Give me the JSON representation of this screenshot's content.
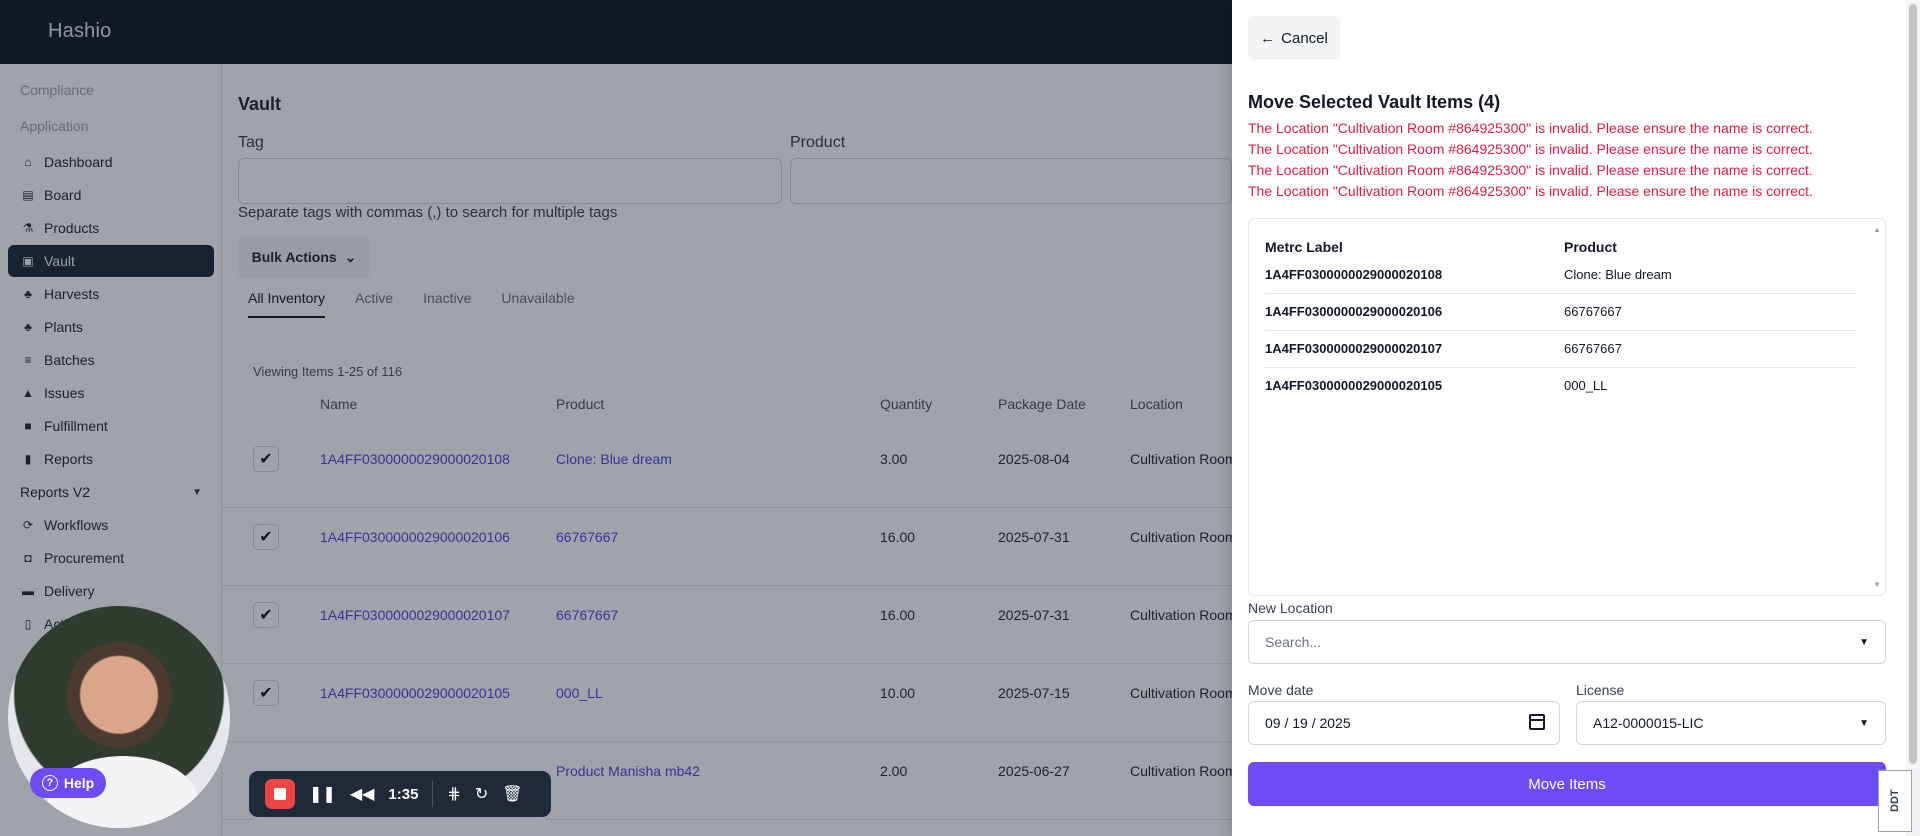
{
  "app": {
    "brand": "Hashio"
  },
  "sidebar": {
    "sections": [
      "Compliance",
      "Application"
    ],
    "items": [
      {
        "label": "Dashboard",
        "icon": "home-icon"
      },
      {
        "label": "Board",
        "icon": "board-icon"
      },
      {
        "label": "Products",
        "icon": "flask-icon"
      },
      {
        "label": "Vault",
        "icon": "vault-icon",
        "active": true
      },
      {
        "label": "Harvests",
        "icon": "sprout-icon"
      },
      {
        "label": "Plants",
        "icon": "plant-icon"
      },
      {
        "label": "Batches",
        "icon": "layers-icon"
      },
      {
        "label": "Issues",
        "icon": "warning-icon"
      },
      {
        "label": "Fulfillment",
        "icon": "box-icon"
      },
      {
        "label": "Reports",
        "icon": "bar-chart-icon"
      },
      {
        "label": "Reports V2",
        "icon": ""
      },
      {
        "label": "Workflows",
        "icon": "workflow-icon"
      },
      {
        "label": "Procurement",
        "icon": "bag-icon"
      },
      {
        "label": "Delivery",
        "icon": "truck-icon"
      },
      {
        "label": "Acti",
        "icon": "doc-icon"
      }
    ]
  },
  "main": {
    "title": "Vault",
    "tag_label": "Tag",
    "product_label": "Product",
    "hint": "Separate tags with commas (,) to search for multiple tags",
    "bulk_actions": "Bulk Actions",
    "tabs": [
      "All Inventory",
      "Active",
      "Inactive",
      "Unavailable"
    ],
    "viewing": "Viewing Items 1-25 of 116",
    "columns": [
      "Name",
      "Product",
      "Quantity",
      "Package Date",
      "Location"
    ],
    "rows": [
      {
        "name": "1A4FF0300000029000020108",
        "product": "Clone: Blue dream",
        "qty": "3.00",
        "date": "2025-08-04",
        "location": "Cultivation Room",
        "checked": true
      },
      {
        "name": "1A4FF0300000029000020106",
        "product": "66767667",
        "qty": "16.00",
        "date": "2025-07-31",
        "location": "Cultivation Room",
        "checked": true
      },
      {
        "name": "1A4FF0300000029000020107",
        "product": "66767667",
        "qty": "16.00",
        "date": "2025-07-31",
        "location": "Cultivation Room",
        "checked": true
      },
      {
        "name": "1A4FF0300000029000020105",
        "product": "000_LL",
        "qty": "10.00",
        "date": "2025-07-15",
        "location": "Cultivation Room",
        "checked": true
      },
      {
        "name": "",
        "product": "Product Manisha mb42",
        "qty": "2.00",
        "date": "2025-06-27",
        "location": "Cultivation Room",
        "checked": false
      }
    ]
  },
  "drawer": {
    "cancel": "Cancel",
    "title": "Move Selected Vault Items (4)",
    "errors": [
      "The Location \"Cultivation Room #864925300\" is invalid. Please ensure the name is correct.",
      "The Location \"Cultivation Room #864925300\" is invalid. Please ensure the name is correct.",
      "The Location \"Cultivation Room #864925300\" is invalid. Please ensure the name is correct.",
      "The Location \"Cultivation Room #864925300\" is invalid. Please ensure the name is correct."
    ],
    "table_headers": [
      "Metrc Label",
      "Product"
    ],
    "items": [
      {
        "label": "1A4FF0300000029000020108",
        "product": "Clone: Blue dream"
      },
      {
        "label": "1A4FF0300000029000020106",
        "product": "66767667"
      },
      {
        "label": "1A4FF0300000029000020107",
        "product": "66767667"
      },
      {
        "label": "1A4FF0300000029000020105",
        "product": "000_LL"
      }
    ],
    "new_location_label": "New Location",
    "new_location_placeholder": "Search...",
    "move_date_label": "Move date",
    "move_date_value": "09 / 19 / 2025",
    "license_label": "License",
    "license_value": "A12-0000015-LIC",
    "move_button": "Move Items"
  },
  "recorder": {
    "help": "Help",
    "time": "1:35"
  },
  "watermark": "DDT",
  "colors": {
    "accent": "#6d4cf5",
    "error": "#e11d48",
    "topbar": "#111827",
    "link": "#4f46e5"
  }
}
